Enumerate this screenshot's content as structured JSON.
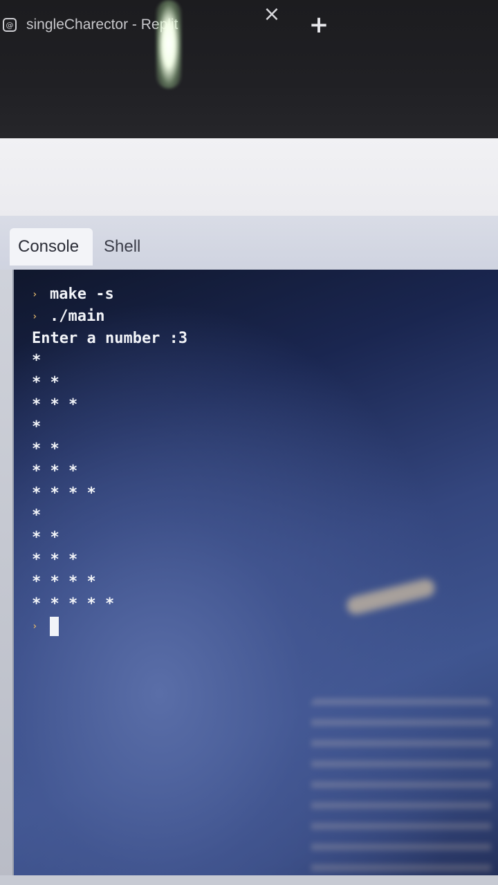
{
  "browser": {
    "tab_icon": "replit-icon",
    "tab_title": "singleCharector - Replit",
    "close_glyph": "×",
    "new_tab_glyph": "+"
  },
  "panel": {
    "tabs": [
      {
        "label": "Console",
        "active": true
      },
      {
        "label": "Shell",
        "active": false
      }
    ]
  },
  "console": {
    "prompt_glyph": "›",
    "commands": [
      "make -s",
      "./main"
    ],
    "input_prompt": "Enter a number :3",
    "output_lines": [
      "*",
      "* *",
      "* * *",
      "*",
      "* *",
      "* * *",
      "* * * *",
      "*",
      "* *",
      "* * *",
      "* * * *",
      "* * * * *"
    ]
  },
  "colors": {
    "console_bg": "#2a3a6a",
    "console_text": "#f2f4f8",
    "prompt": "#d7b06a",
    "chrome_bg": "#1c1c1f"
  }
}
